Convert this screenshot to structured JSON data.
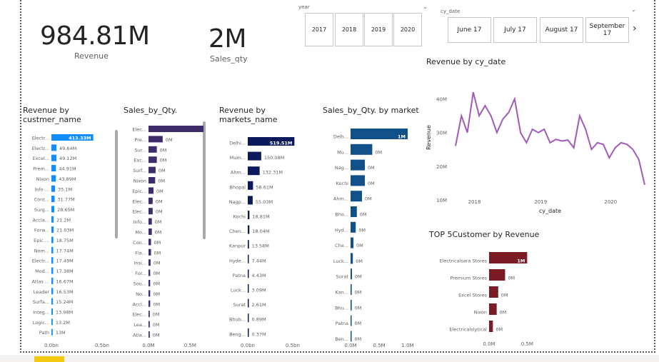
{
  "kpis": [
    {
      "id": "revenue",
      "value": "984.81M",
      "label": "Revenue"
    },
    {
      "id": "sales_qty",
      "value": "2M",
      "label": "Sales_qty"
    }
  ],
  "year_slicer": {
    "title": "year",
    "options": [
      "2017",
      "2018",
      "2019",
      "2020"
    ]
  },
  "date_slicer": {
    "title": "cy_date",
    "options": [
      "June 17",
      "July 17",
      "August 17",
      "September 17"
    ]
  },
  "colors": {
    "revenue_customer": "#118dff",
    "qty_customer": "#3f2d6b",
    "revenue_market": "#0b1a5c",
    "qty_market": "#12508a",
    "line": "#a259b8",
    "top5": "#7b1b24"
  },
  "charts": {
    "rev_customer": {
      "title": "Revenue by custmer_name",
      "axis": [
        "0.0bn",
        "0.5bn"
      ]
    },
    "qty_customer": {
      "title": "Sales_by_Qty.",
      "axis": [
        "0.0M",
        "0.5M"
      ]
    },
    "rev_market": {
      "title": "Revenue by markets_name",
      "axis": [
        "0.0bn",
        "0.5bn"
      ]
    },
    "qty_market": {
      "title": "Sales_by_Qty. by market",
      "axis": [
        "0.0M",
        "0.5M",
        "1.0M"
      ]
    },
    "line": {
      "title": "Revenue by cy_date",
      "xlabel": "cy_date",
      "ylabel": "Revenue"
    },
    "top5": {
      "title": "TOP 5Customer by Revenue",
      "axis": [
        "0.0M",
        "0.5M"
      ]
    }
  },
  "chart_data": [
    {
      "type": "bar",
      "id": "rev_customer",
      "title": "Revenue by custmer_name",
      "unit": "M",
      "xlim": [
        0,
        620
      ],
      "categories": [
        "Electr...",
        "Electr...",
        "Excel...",
        "Prem...",
        "Nixon",
        "Info ...",
        "Cont...",
        "Surg...",
        "Accla...",
        "Forw...",
        "Epic ...",
        "Nom...",
        "Electr...",
        "Mod...",
        "Atlas ...",
        "Leader",
        "Surfa...",
        "Integ...",
        "Logic...",
        "Path"
      ],
      "values": [
        413.33,
        49.64,
        49.12,
        44.91,
        43.89,
        35.1,
        31.77,
        28.65,
        21.2,
        21.03,
        18.75,
        17.74,
        17.49,
        17.38,
        16.67,
        16.53,
        15.24,
        13.98,
        13.2,
        13
      ],
      "labels": [
        "413.33M",
        "49.64M",
        "49.12M",
        "44.91M",
        "43.89M",
        "35.1M",
        "31.77M",
        "28.65M",
        "21.2M",
        "21.03M",
        "18.75M",
        "17.74M",
        "17.49M",
        "17.38M",
        "16.67M",
        "16.53M",
        "15.24M",
        "13.98M",
        "13.2M",
        "13M"
      ]
    },
    {
      "type": "bar",
      "id": "qty_customer",
      "title": "Sales_by_Qty.",
      "xlim": [
        0,
        0.6
      ],
      "categories": [
        "Elec...",
        "Pre...",
        "Sur...",
        "Exc...",
        "Surf...",
        "Nixon",
        "Epic...",
        "Elec...",
        "Elec...",
        "Info...",
        "Mo...",
        "Con...",
        "Fla...",
        "Insi...",
        "For...",
        "Sou...",
        "No...",
        "Accl...",
        "Elec...",
        "Lea...",
        "Atla..."
      ],
      "values": [
        1.0,
        0.17,
        0.1,
        0.1,
        0.085,
        0.08,
        0.06,
        0.05,
        0.05,
        0.04,
        0.04,
        0.03,
        0.03,
        0.025,
        0.02,
        0.02,
        0.02,
        0.02,
        0.015,
        0.015,
        0.015
      ],
      "labels": [
        "1M",
        "0M",
        "0M",
        "0M",
        "0M",
        "0M",
        "0M",
        "0M",
        "0M",
        "0M",
        "0M",
        "0M",
        "0M",
        "0M",
        "0M",
        "0M",
        "0M",
        "0M",
        "0M",
        "0M",
        "0M"
      ]
    },
    {
      "type": "bar",
      "id": "rev_market",
      "title": "Revenue by markets_name",
      "unit": "M",
      "xlim": [
        0,
        620
      ],
      "categories": [
        "Delhi...",
        "Mum...",
        "Ahm...",
        "Bhopal",
        "Nagp...",
        "Kochi",
        "Chen...",
        "Kanpur",
        "Hyde...",
        "Patna",
        "Luck...",
        "Surat",
        "Bhub...",
        "Beng..."
      ],
      "values": [
        519.51,
        150.08,
        132.31,
        58.61,
        55.03,
        18.81,
        18.04,
        13.58,
        7.44,
        4.43,
        3.09,
        2.61,
        0.89,
        0.37
      ],
      "labels": [
        "519.51M",
        "150.08M",
        "132.31M",
        "58.61M",
        "55.03M",
        "18.81M",
        "18.04M",
        "13.58M",
        "7.44M",
        "4.43M",
        "3.09M",
        "2.61M",
        "0.89M",
        "0.37M"
      ]
    },
    {
      "type": "bar",
      "id": "qty_market",
      "title": "Sales_by_Qty. by market",
      "xlim": [
        0,
        1.0
      ],
      "categories": [
        "Delh...",
        "Mu...",
        "Nag...",
        "Kochi",
        "Ahm...",
        "Bho...",
        "Hyd...",
        "Che...",
        "Luck...",
        "Surat",
        "Kan...",
        "Bhu...",
        "Patna",
        "Ben..."
      ],
      "values": [
        1.0,
        0.38,
        0.25,
        0.25,
        0.2,
        0.11,
        0.09,
        0.05,
        0.04,
        0.025,
        0.02,
        0.02,
        0.004,
        0.004
      ],
      "labels": [
        "1M",
        "0M",
        "0M",
        "0M",
        "0M",
        "0M",
        "0M",
        "0M",
        "0M",
        "0M",
        "0M",
        "0M",
        "0M",
        "0M"
      ]
    },
    {
      "type": "line",
      "id": "line",
      "title": "Revenue by cy_date",
      "xlabel": "cy_date",
      "ylabel": "Revenue",
      "x_ticks": [
        "2018",
        "2019",
        "2020"
      ],
      "y_ticks": [
        "10M",
        "20M",
        "30M",
        "40M"
      ],
      "ylim": [
        10,
        45
      ],
      "values": [
        26,
        35,
        30,
        42,
        35,
        38,
        35,
        30,
        34,
        36,
        40,
        30,
        27,
        31,
        30,
        31,
        27,
        28,
        27.5,
        27.8,
        25.5,
        35,
        31,
        25,
        27,
        26.5,
        22.5,
        25.5,
        27,
        26.5,
        25,
        22,
        14.5
      ]
    },
    {
      "type": "bar",
      "id": "top5",
      "title": "TOP 5Customer by Revenue",
      "xlim": [
        0,
        0.75
      ],
      "categories": [
        "Electricalsara Stores",
        "Premium Stores",
        "Excel Stores",
        "Nixon",
        "Electricalslytical"
      ],
      "values": [
        0.5,
        0.21,
        0.12,
        0.1,
        0.05
      ],
      "labels": [
        "1M",
        "0M",
        "0M",
        "0M",
        "0M"
      ]
    }
  ]
}
